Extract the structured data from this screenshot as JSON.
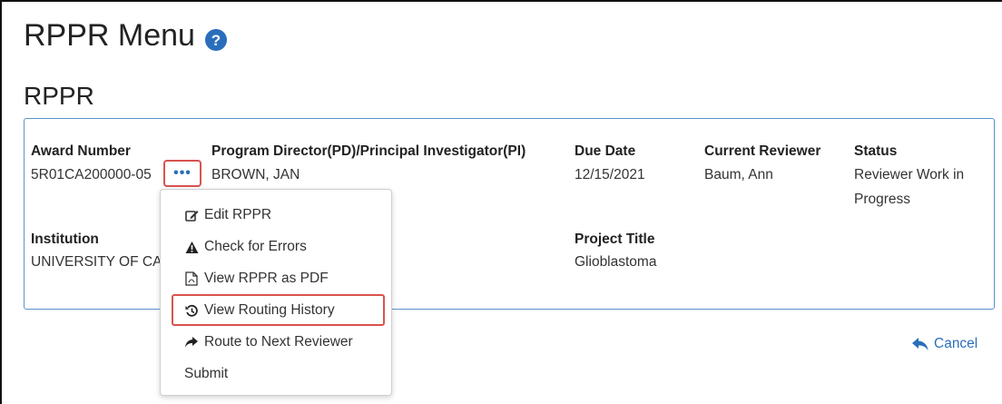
{
  "header": {
    "title": "RPPR Menu",
    "help_icon": "question-circle-icon"
  },
  "section": {
    "title": "RPPR"
  },
  "award": {
    "award_number_label": "Award Number",
    "award_number": "5R01CA200000-05",
    "pd_pi_label": "Program Director(PD)/Principal Investigator(PI)",
    "pd_pi": "BROWN, JAN",
    "due_date_label": "Due Date",
    "due_date": "12/15/2021",
    "current_reviewer_label": "Current Reviewer",
    "current_reviewer": "Baum, Ann",
    "status_label": "Status",
    "status_line1": "Reviewer Work in",
    "status_line2": "Progress",
    "institution_label": "Institution",
    "institution": "UNIVERSITY OF CA",
    "project_title_label": "Project Title",
    "project_title": "Glioblastoma"
  },
  "actions_button": {
    "label": "•••",
    "icon": "ellipsis-icon"
  },
  "dropdown": {
    "items": [
      {
        "label": "Edit RPPR",
        "icon": "edit-icon"
      },
      {
        "label": "Check for Errors",
        "icon": "warning-icon"
      },
      {
        "label": "View RPPR as PDF",
        "icon": "pdf-icon"
      },
      {
        "label": "View Routing History",
        "icon": "history-icon"
      },
      {
        "label": "Route to Next Reviewer",
        "icon": "share-icon"
      },
      {
        "label": "Submit",
        "icon": ""
      }
    ],
    "highlighted_item": "View Routing History"
  },
  "footer": {
    "cancel_label": "Cancel",
    "cancel_icon": "reply-icon"
  },
  "colors": {
    "accent": "#2a6ebb",
    "highlight": "#d9534f",
    "panel_border": "#5a92c8"
  }
}
